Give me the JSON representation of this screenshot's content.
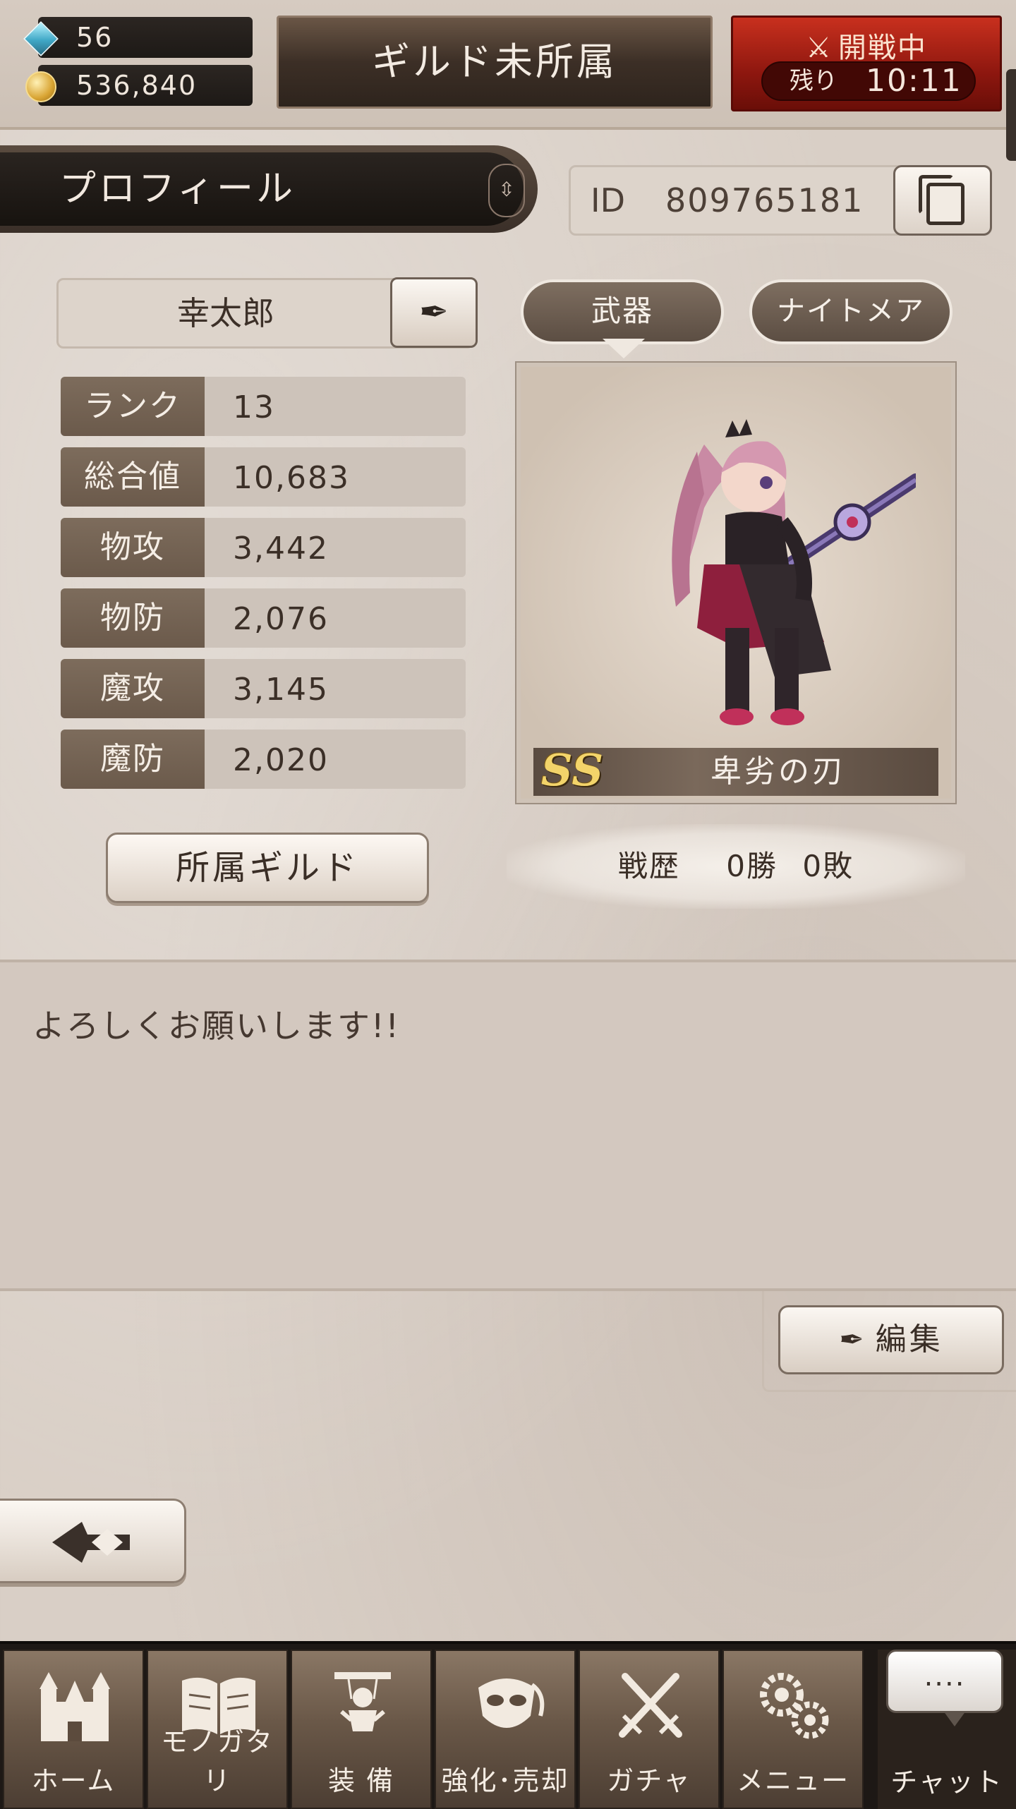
{
  "header": {
    "gems": "56",
    "coins": "536,840",
    "guild_status": "ギルド未所属",
    "war_status": "開戦中",
    "war_remaining_label": "残り",
    "war_remaining_time": "10:11"
  },
  "profile": {
    "tab_title": "プロフィール",
    "id_label": "ID",
    "id_value": "809765181",
    "name": "幸太郎",
    "stats": [
      {
        "label": "ランク",
        "value": "13"
      },
      {
        "label": "総合値",
        "value": "10,683"
      },
      {
        "label": "物攻",
        "value": "3,442"
      },
      {
        "label": "物防",
        "value": "2,076"
      },
      {
        "label": "魔攻",
        "value": "3,145"
      },
      {
        "label": "魔防",
        "value": "2,020"
      }
    ],
    "guild_button": "所属ギルド",
    "tabs": {
      "weapon": "武器",
      "nightmare": "ナイトメア"
    },
    "weapon": {
      "rarity": "SS",
      "name": "卑劣の刃"
    },
    "record": {
      "label": "戦歴",
      "wins": "0勝",
      "losses": "0敗"
    }
  },
  "message": {
    "text": "よろしくお願いします!!",
    "edit_label": "編集"
  },
  "nav": {
    "items": [
      {
        "label": "ホーム",
        "icon": "castle-icon"
      },
      {
        "label": "モノガタリ",
        "icon": "book-icon"
      },
      {
        "label": "装 備",
        "icon": "puppet-icon"
      },
      {
        "label": "強化･売却",
        "icon": "mask-icon"
      },
      {
        "label": "ガチャ",
        "icon": "swords-icon"
      },
      {
        "label": "メニュー",
        "icon": "gears-icon"
      }
    ],
    "chat_bubble": "....",
    "chat_label": "チャット"
  },
  "colors": {
    "war_red": "#b5251a",
    "panel_dark": "#2a2420",
    "stat_label_bg": "#766555",
    "rarity_gold": "#f3d46a"
  }
}
